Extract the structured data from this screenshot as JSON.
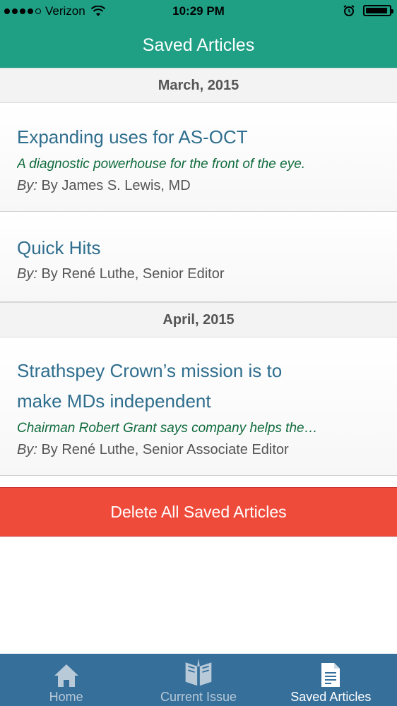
{
  "status_bar": {
    "carrier": "Verizon",
    "time": "10:29 PM",
    "signal_bars_filled": 4,
    "signal_bars_total": 5,
    "battery_level": 0.95
  },
  "nav": {
    "title": "Saved Articles"
  },
  "sections": [
    {
      "header": "March, 2015",
      "articles": [
        {
          "title": "Expanding uses for AS-OCT",
          "subtitle": "A diagnostic powerhouse for the front of the eye.",
          "by_label": "By:",
          "author": "By James S. Lewis, MD"
        },
        {
          "title": "Quick Hits",
          "subtitle": "",
          "by_label": "By:",
          "author": "By René Luthe, Senior Editor"
        }
      ]
    },
    {
      "header": "April, 2015",
      "articles": [
        {
          "title_line1": "Strathspey Crown’s mission is to",
          "title_line2": "make MDs independent",
          "subtitle": "Chairman Robert Grant says company helps the…",
          "by_label": "By:",
          "author": "By René Luthe, Senior Associate Editor"
        }
      ]
    }
  ],
  "delete_button": {
    "label": "Delete All Saved Articles"
  },
  "tabs": [
    {
      "label": "Home",
      "icon": "home-icon",
      "active": false
    },
    {
      "label": "Current Issue",
      "icon": "open-book-icon",
      "active": false
    },
    {
      "label": "Saved Articles",
      "icon": "document-icon",
      "active": true
    }
  ],
  "colors": {
    "header_green": "#1fa085",
    "title_blue": "#2f6e8e",
    "subtitle_green": "#0f6b3c",
    "delete_red": "#ef4b3b",
    "tabbar_blue": "#356f9a"
  }
}
